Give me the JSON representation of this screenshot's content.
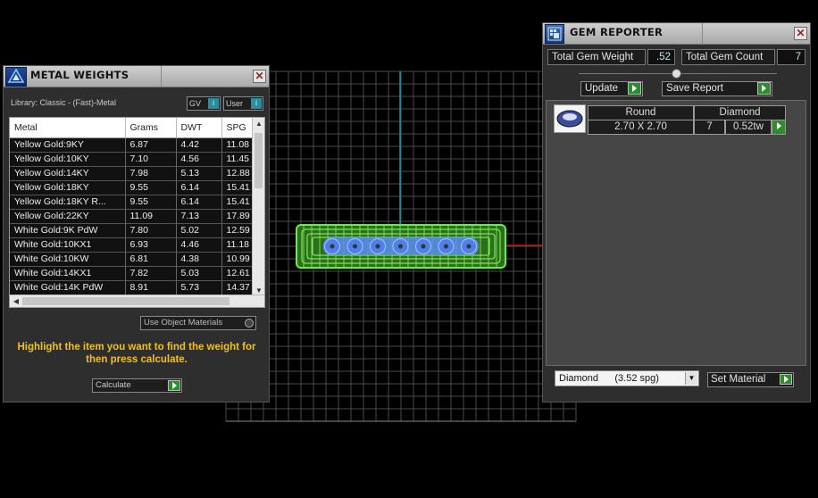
{
  "metal_weights": {
    "title": "METAL WEIGHTS",
    "close_glyph": "✕",
    "library_label": "Library: Classic - (Fast)-Metal",
    "unit_select": "GV",
    "source_select": "User",
    "columns": [
      "Metal",
      "Grams",
      "DWT",
      "SPG"
    ],
    "rows": [
      [
        "Yellow Gold:9KY",
        "6.87",
        "4.42",
        "11.08"
      ],
      [
        "Yellow Gold:10KY",
        "7.10",
        "4.56",
        "11.45"
      ],
      [
        "Yellow Gold:14KY",
        "7.98",
        "5.13",
        "12.88"
      ],
      [
        "Yellow Gold:18KY",
        "9.55",
        "6.14",
        "15.41"
      ],
      [
        "Yellow Gold:18KY R...",
        "9.55",
        "6.14",
        "15.41"
      ],
      [
        "Yellow Gold:22KY",
        "11.09",
        "7.13",
        "17.89"
      ],
      [
        "White Gold:9K PdW",
        "7.80",
        "5.02",
        "12.59"
      ],
      [
        "White Gold:10KX1",
        "6.93",
        "4.46",
        "11.18"
      ],
      [
        "White Gold:10KW",
        "6.81",
        "4.38",
        "10.99"
      ],
      [
        "White Gold:14KX1",
        "7.82",
        "5.03",
        "12.61"
      ],
      [
        "White Gold:14K PdW",
        "8.91",
        "5.73",
        "14.37"
      ]
    ],
    "use_object_materials": "Use Object Materials",
    "hint": "Highlight the item you want to find the weight for then press calculate.",
    "calculate_label": "Calculate"
  },
  "gem_reporter": {
    "title": "GEM REPORTER",
    "close_glyph": "✕",
    "total_weight_label": "Total Gem Weight",
    "total_weight_value": ".52",
    "total_count_label": "Total Gem Count",
    "total_count_value": "7",
    "update_label": "Update",
    "save_report_label": "Save Report",
    "gem_row": {
      "shape": "Round",
      "material": "Diamond",
      "size": "2.70 X 2.70",
      "count": "7",
      "weight": "0.52tw"
    },
    "material_select": "Diamond      (3.52 spg)",
    "set_material_label": "Set Material"
  },
  "colors": {
    "accent_green": "#2c8d2c",
    "hint_yellow": "#f2c01a",
    "value_cyan": "#bfe9f5",
    "model_green": "#62f04a",
    "gem_blue": "#5a8df5"
  }
}
